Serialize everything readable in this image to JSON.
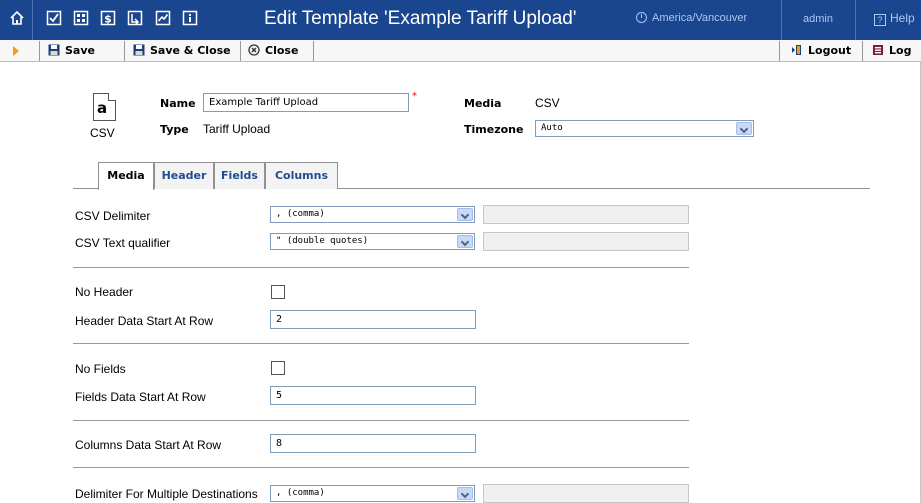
{
  "window": {
    "title": "Edit Template 'Example Tariff Upload'",
    "timezone_link": "America/Vancouver",
    "user_link": "admin",
    "help_link": "Help",
    "help_box_glyph": "?"
  },
  "toolbar": {
    "save_label": "Save",
    "save_close_label": "Save & Close",
    "close_label": "Close",
    "logout_label": "Logout",
    "log_label": "Log"
  },
  "template": {
    "icon_letter": "a",
    "icon_caption": "CSV",
    "name_label": "Name",
    "name_value": "Example Tariff Upload",
    "required_mark": "*",
    "type_label": "Type",
    "type_value": "Tariff Upload",
    "media_label": "Media",
    "media_value": "CSV",
    "timezone_label": "Timezone",
    "timezone_value": "Auto"
  },
  "tabs": [
    {
      "label": "Media",
      "active": true
    },
    {
      "label": "Header",
      "active": false
    },
    {
      "label": "Fields",
      "active": false
    },
    {
      "label": "Columns",
      "active": false
    }
  ],
  "form": {
    "csv_delimiter_label": "CSV Delimiter",
    "csv_delimiter_value": ", (comma)",
    "csv_text_qualifier_label": "CSV Text qualifier",
    "csv_text_qualifier_value": "\" (double quotes)",
    "no_header_label": "No Header",
    "no_header_checked": false,
    "header_start_label": "Header Data Start At Row",
    "header_start_value": "2",
    "no_fields_label": "No Fields",
    "no_fields_checked": false,
    "fields_start_label": "Fields Data Start At Row",
    "fields_start_value": "5",
    "columns_start_label": "Columns Data Start At Row",
    "columns_start_value": "8",
    "multi_dest_delimiter_label": "Delimiter For Multiple Destinations",
    "multi_dest_delimiter_value": ", (comma)"
  },
  "colors": {
    "title_bar": "#19468f",
    "link": "#a9c7f2",
    "tab_text": "#1f4c8f"
  },
  "icons": [
    "home-icon",
    "checkbox-icon",
    "grid-icon",
    "dollar-icon",
    "import-icon",
    "chart-icon",
    "info-icon",
    "clock-icon",
    "help-icon",
    "play-icon",
    "floppy-icon",
    "close-circle-icon",
    "logout-icon",
    "log-icon",
    "csv-file-icon",
    "chevron-down-icon"
  ]
}
